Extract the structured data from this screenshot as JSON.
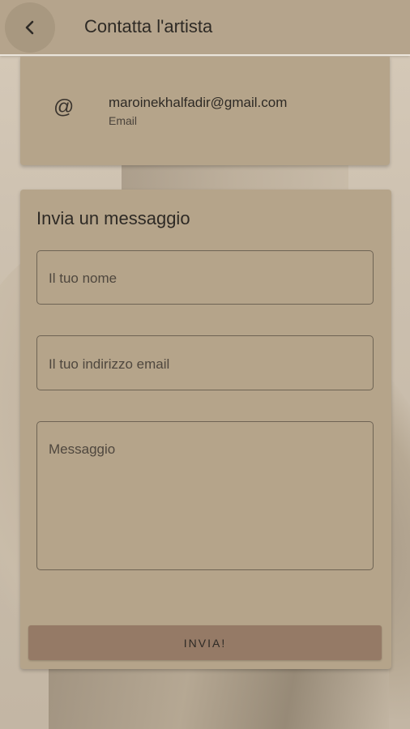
{
  "header": {
    "title": "Contatta l'artista"
  },
  "contact": {
    "email_value": "maroinekhalfadir@gmail.com",
    "email_label": "Email",
    "at_symbol": "@"
  },
  "form": {
    "title": "Invia un messaggio",
    "name_placeholder": "Il tuo nome",
    "email_placeholder": "Il tuo indirizzo email",
    "message_placeholder": "Messaggio",
    "send_label": "INVIA!"
  },
  "colors": {
    "appbar": "#b5a48c",
    "card": "#b5a48a",
    "button": "#957a66"
  }
}
